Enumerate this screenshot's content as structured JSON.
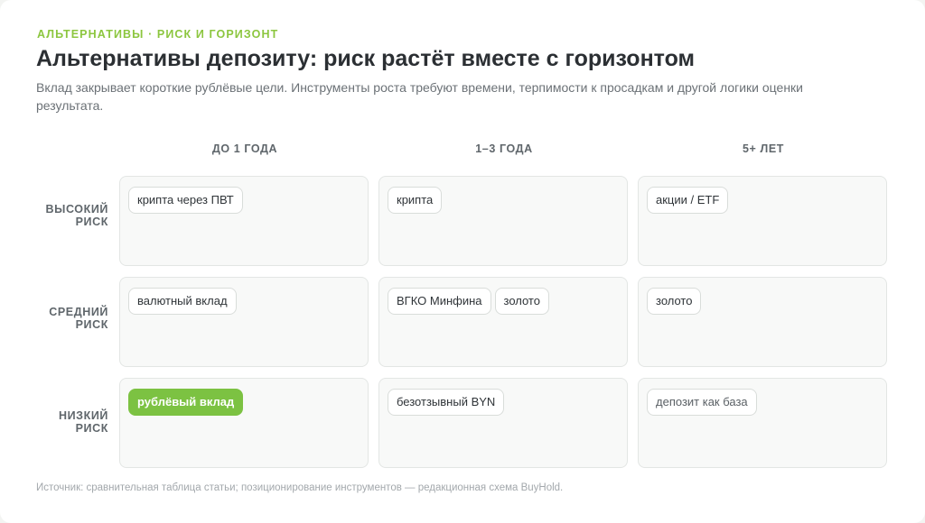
{
  "eyebrow": "АЛЬТЕРНАТИВЫ · РИСК И ГОРИЗОНТ",
  "title": "Альтернативы депозиту: риск растёт вместе с горизонтом",
  "subtitle": "Вклад закрывает короткие рублёвые цели. Инструменты роста требуют времени, терпимости к просадкам и другой логики оценки результата.",
  "columns": [
    "ДО 1 ГОДА",
    "1–3 ГОДА",
    "5+ ЛЕТ"
  ],
  "rows": [
    {
      "label": "ВЫСОКИЙ РИСК",
      "cells": [
        [
          "крипта через ПВТ"
        ],
        [
          "крипта"
        ],
        [
          "акции / ETF"
        ]
      ]
    },
    {
      "label": "СРЕДНИЙ РИСК",
      "cells": [
        [
          "валютный вклад"
        ],
        [
          "ВГКО Минфина",
          "золото"
        ],
        [
          "золото"
        ]
      ]
    },
    {
      "label": "НИЗКИЙ РИСК",
      "cells": [
        [
          "рублёвый вклад"
        ],
        [
          "безотзывный BYN"
        ],
        [
          "депозит как база"
        ]
      ]
    }
  ],
  "highlighted_chip": "рублёвый вклад",
  "muted_chip": "депозит как база",
  "colors": {
    "accent": "#7cc242",
    "eyebrow": "#8cc63f",
    "title": "#2b2f33"
  },
  "source": "Источник: сравнительная таблица статьи; позиционирование инструментов — редакционная схема BuyHold."
}
